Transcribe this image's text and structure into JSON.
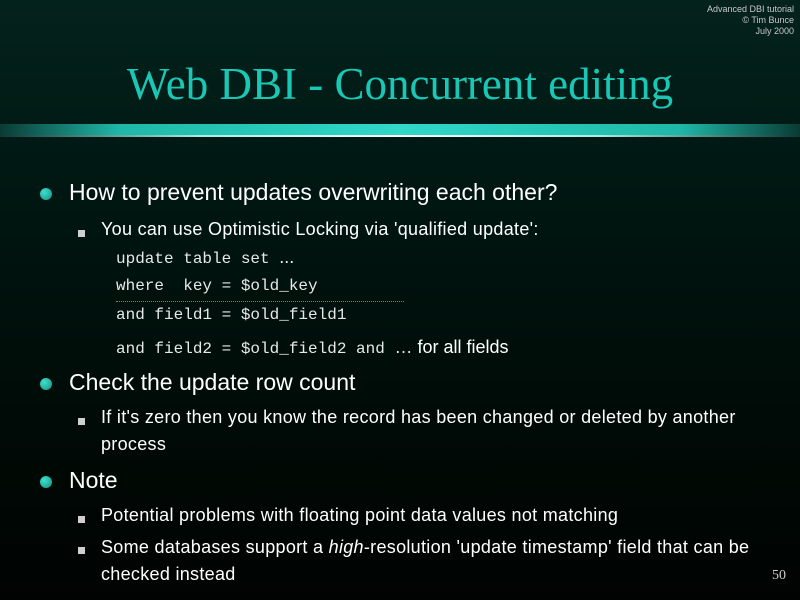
{
  "corner_note": {
    "line1": "Advanced DBI tutorial",
    "line2": "© Tim Bunce",
    "line3": "July 2000"
  },
  "title": "Web DBI - Concurrent editing",
  "colors": {
    "title": "#19c8b4",
    "bullet": "#1fb8a8",
    "background": "#001712"
  },
  "bullets": [
    {
      "text": "How to prevent updates overwriting each other?",
      "sub": [
        "You can use Optimistic Locking via 'qualified update':"
      ],
      "code": [
        {
          "code": "update table set ",
          "tail": "..."
        },
        {
          "code": "where  key = $old_key"
        },
        {
          "code": "and field1 = $old_field1"
        },
        {
          "code": "and field2 = $old_field2 and ",
          "tail": "…",
          "prose": " for all fields"
        }
      ]
    },
    {
      "text": "Check the update row count",
      "sub": [
        "If it's zero then you know the record has been changed or deleted by another process"
      ]
    },
    {
      "text": "Note",
      "sub": [
        "Potential problems with floating point data values not matching",
        {
          "before": "Some databases support a ",
          "em": "high",
          "after": "-resolution 'update timestamp' field that can be checked instead"
        }
      ]
    }
  ],
  "page_number": "50"
}
